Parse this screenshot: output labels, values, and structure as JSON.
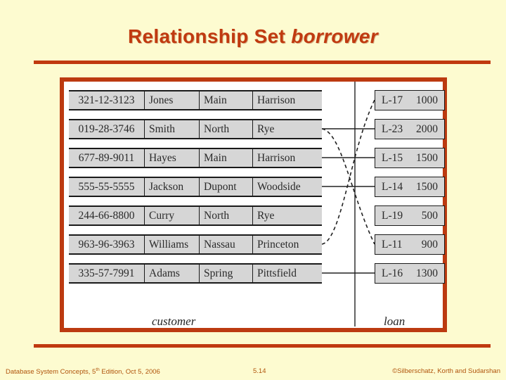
{
  "title": {
    "text_plain": "Relationship Set ",
    "text_italic": "borrower"
  },
  "figure": {
    "customer": {
      "caption": "customer",
      "columns": [
        "customer_id",
        "customer_name",
        "customer_street",
        "customer_city"
      ],
      "rows": [
        {
          "id": "321-12-3123",
          "name": "Jones",
          "street": "Main",
          "city": "Harrison"
        },
        {
          "id": "019-28-3746",
          "name": "Smith",
          "street": "North",
          "city": "Rye"
        },
        {
          "id": "677-89-9011",
          "name": "Hayes",
          "street": "Main",
          "city": "Harrison"
        },
        {
          "id": "555-55-5555",
          "name": "Jackson",
          "street": "Dupont",
          "city": "Woodside"
        },
        {
          "id": "244-66-8800",
          "name": "Curry",
          "street": "North",
          "city": "Rye"
        },
        {
          "id": "963-96-3963",
          "name": "Williams",
          "street": "Nassau",
          "city": "Princeton"
        },
        {
          "id": "335-57-7991",
          "name": "Adams",
          "street": "Spring",
          "city": "Pittsfield"
        }
      ]
    },
    "loan": {
      "caption": "loan",
      "columns": [
        "loan_number",
        "amount"
      ],
      "rows": [
        {
          "number": "L-17",
          "amount": "1000"
        },
        {
          "number": "L-23",
          "amount": "2000"
        },
        {
          "number": "L-15",
          "amount": "1500"
        },
        {
          "number": "L-14",
          "amount": "1500"
        },
        {
          "number": "L-19",
          "amount": "500"
        },
        {
          "number": "L-11",
          "amount": "900"
        },
        {
          "number": "L-16",
          "amount": "1300"
        }
      ]
    },
    "relationships": [
      {
        "customer": "Smith",
        "loan": "L-23",
        "style": "straight"
      },
      {
        "customer": "Smith",
        "loan": "L-11",
        "style": "curved"
      },
      {
        "customer": "Hayes",
        "loan": "L-15",
        "style": "straight"
      },
      {
        "customer": "Jackson",
        "loan": "L-14",
        "style": "straight"
      },
      {
        "customer": "Williams",
        "loan": "L-17",
        "style": "curved"
      },
      {
        "customer": "Adams",
        "loan": "L-16",
        "style": "straight"
      }
    ]
  },
  "footer": {
    "left_before_sup": "Database System Concepts, 5",
    "left_sup": "th",
    "left_after_sup": " Edition, Oct 5, 2006",
    "center": "5.14",
    "right": "©Silberschatz, Korth and Sudarshan"
  },
  "colors": {
    "background": "#FDFBD0",
    "accent": "#C0390F",
    "frame": "#BC3A10",
    "cell_fill": "#D6D6D6",
    "footer_text": "#B0540C"
  }
}
